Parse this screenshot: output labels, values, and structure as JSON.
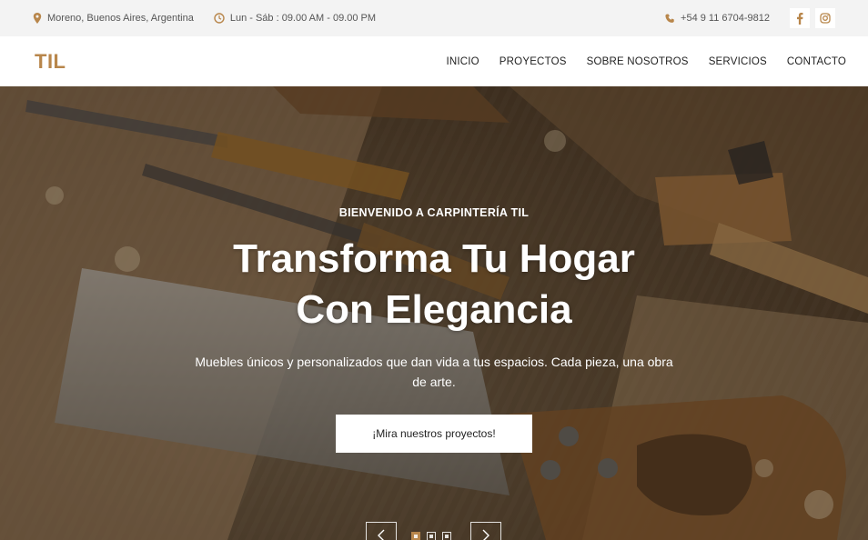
{
  "topbar": {
    "location": "Moreno, Buenos Aires, Argentina",
    "hours": "Lun - Sáb : 09.00 AM - 09.00 PM",
    "phone": "+54 9 11 6704-9812",
    "icons": [
      "location-pin-icon",
      "clock-icon",
      "phone-icon",
      "facebook-icon",
      "instagram-icon"
    ]
  },
  "nav": {
    "logo": "TIL",
    "items": [
      "INICIO",
      "PROYECTOS",
      "SOBRE NOSOTROS",
      "SERVICIOS",
      "CONTACTO"
    ]
  },
  "hero": {
    "welcome": "BIENVENIDO A CARPINTERÍA TIL",
    "headline_line1": "Transforma Tu Hogar",
    "headline_line2": "Con Elegancia",
    "subtitle": "Muebles únicos y personalizados que dan vida a tus espacios. Cada pieza, una obra de arte.",
    "cta": "¡Mira nuestros proyectos!",
    "slides": 3,
    "active_slide": 1
  },
  "colors": {
    "accent": "#b8864b",
    "topbar_bg": "#f3f3f3"
  }
}
